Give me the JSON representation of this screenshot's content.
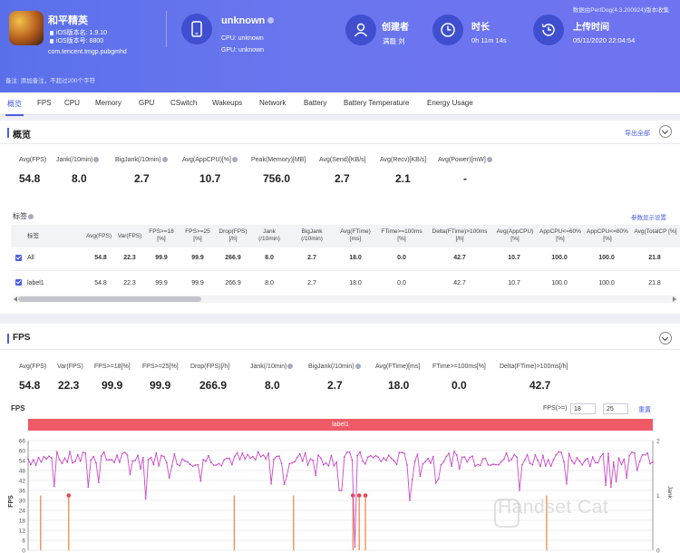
{
  "header": {
    "app_name": "和平精英",
    "ios_version": "iOS版本名: 1.9.10",
    "ios_build": "iOS版本号: 8800",
    "package": "com.tencent.tmgp.pubgmhd",
    "device_name": "unknown",
    "cpu": "CPU: unknown",
    "gpu": "GPU: unknown",
    "creator_label": "创建者",
    "creator_value": "满磊 刘",
    "duration_label": "时长",
    "duration_value": "0h 11m 14s",
    "upload_label": "上传时间",
    "upload_value": "05/11/2020 22:04:54",
    "source_note": "数据由PerfDog(4.3.200924)版本收集",
    "remark": "备注: 添加备注，不超过200个字符"
  },
  "tabs": [
    "概览",
    "FPS",
    "CPU",
    "Memory",
    "GPU",
    "CSwitch",
    "Wakeups",
    "Network",
    "Battery",
    "Battery Temperature",
    "Energy Usage"
  ],
  "overview": {
    "title": "概览",
    "export_label": "导出全部",
    "stats": [
      {
        "label": "Avg(FPS)",
        "value": "54.8"
      },
      {
        "label": "Jank(/10min)",
        "value": "8.0"
      },
      {
        "label": "BigJank(/10min)",
        "value": "2.7"
      },
      {
        "label": "Avg(AppCPU)[%]",
        "value": "10.7"
      },
      {
        "label": "Peak(Memory)[MB]",
        "value": "756.0"
      },
      {
        "label": "Avg(Send)[KB/s]",
        "value": "2.7"
      },
      {
        "label": "Avg(Recv)[KB/s]",
        "value": "2.1"
      },
      {
        "label": "Avg(Power)[mW]",
        "value": "-"
      }
    ],
    "label_section": "标签",
    "label_link": "参数显示设置",
    "table": {
      "headers": [
        "标签",
        "Avg(FPS)",
        "Var(FPS)",
        "FPS>=18 [%]",
        "FPS>=25 [%]",
        "Drop(FPS) [/h]",
        "Jank (/10min)",
        "BigJank (/10min)",
        "Avg(FTime) [ms]",
        "FTime>=100ms [%]",
        "Delta(FTime)>100ms [/h]",
        "Avg(AppCPU) [%]",
        "AppCPU<=60% [%]",
        "AppCPU<=80% [%]",
        "Avg(TotalCP [%]"
      ],
      "rows": [
        [
          "All",
          "54.8",
          "22.3",
          "99.9",
          "99.9",
          "266.9",
          "8.0",
          "2.7",
          "18.0",
          "0.0",
          "42.7",
          "10.7",
          "100.0",
          "100.0",
          "21.8"
        ],
        [
          "label1",
          "54.8",
          "22.3",
          "99.9",
          "99.9",
          "266.9",
          "8.0",
          "2.7",
          "18.0",
          "0.0",
          "42.7",
          "10.7",
          "100.0",
          "100.0",
          "21.8"
        ]
      ]
    }
  },
  "fps_panel": {
    "title": "FPS",
    "stats": [
      {
        "label": "Avg(FPS)",
        "value": "54.8"
      },
      {
        "label": "Var(FPS)",
        "value": "22.3"
      },
      {
        "label": "FPS>=18[%]",
        "value": "99.9"
      },
      {
        "label": "FPS>=25[%]",
        "value": "99.9"
      },
      {
        "label": "Drop(FPS)[/h]",
        "value": "266.9"
      },
      {
        "label": "Jank(/10min)",
        "value": "8.0"
      },
      {
        "label": "BigJank(/10min)",
        "value": "2.7"
      },
      {
        "label": "Avg(FTime)[ms]",
        "value": "18.0"
      },
      {
        "label": "FTime>=100ms[%]",
        "value": "0.0"
      },
      {
        "label": "Delta(FTime)>100ms[/h]",
        "value": "42.7"
      }
    ],
    "chart_title": "FPS",
    "threshold_label": "FPS(>=)",
    "threshold_a": "18",
    "threshold_b": "25",
    "reset_label": "重置",
    "band_label": "label1"
  },
  "chart_data": {
    "type": "line",
    "title": "FPS",
    "ylabel": "FPS",
    "y2label": "Jank",
    "ylim": [
      0,
      66
    ],
    "y2lim": [
      0,
      2
    ],
    "yticks": [
      "66",
      "60",
      "54",
      "48",
      "42",
      "36",
      "30",
      "24",
      "18",
      "12",
      "6",
      "0"
    ],
    "y2ticks": [
      "2",
      "1",
      "0"
    ],
    "series": [
      {
        "name": "FPS",
        "color": "#c84cc6",
        "baseline": 55,
        "dips": [
          {
            "x": 0.095,
            "y": 38
          },
          {
            "x": 0.19,
            "y": 31
          },
          {
            "x": 0.39,
            "y": 40
          },
          {
            "x": 0.5,
            "y": 36
          },
          {
            "x": 0.525,
            "y": 2
          },
          {
            "x": 0.61,
            "y": 30
          },
          {
            "x": 0.785,
            "y": 36
          },
          {
            "x": 0.86,
            "y": 40
          },
          {
            "x": 0.935,
            "y": 38
          }
        ]
      },
      {
        "name": "Jank",
        "color": "#f08a4b",
        "spikes": [
          0.02,
          0.065,
          0.33,
          0.425,
          0.52,
          0.53,
          0.54,
          0.83
        ]
      },
      {
        "name": "BigJank",
        "color": "#e8484f",
        "spikes": [
          0.065,
          0.52,
          0.53,
          0.54
        ]
      }
    ]
  },
  "watermark": "Handset Cat"
}
